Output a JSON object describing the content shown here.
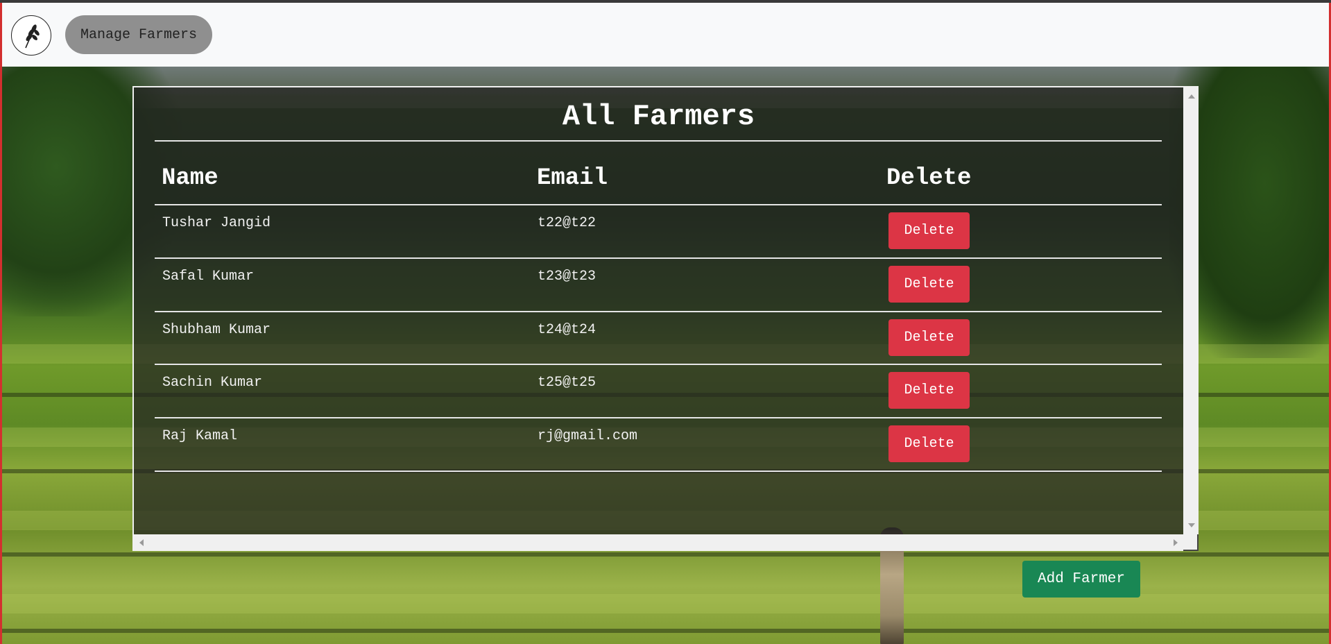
{
  "nav": {
    "logo_icon": "wheat-icon",
    "manage_label": "Manage Farmers"
  },
  "panel": {
    "title": "All Farmers",
    "headers": [
      "Name",
      "Email",
      "Delete"
    ],
    "rows": [
      {
        "name": "Tushar Jangid",
        "email": "t22@t22",
        "action": "Delete"
      },
      {
        "name": "Safal Kumar",
        "email": "t23@t23",
        "action": "Delete"
      },
      {
        "name": "Shubham Kumar",
        "email": "t24@t24",
        "action": "Delete"
      },
      {
        "name": "Sachin Kumar",
        "email": "t25@t25",
        "action": "Delete"
      },
      {
        "name": "Raj Kamal",
        "email": "rj@gmail.com",
        "action": "Delete"
      }
    ]
  },
  "add_button_label": "Add Farmer",
  "colors": {
    "delete": "#dc3545",
    "add": "#198754",
    "navbar": "#f8f9fa",
    "pill": "#8f8f8f"
  }
}
